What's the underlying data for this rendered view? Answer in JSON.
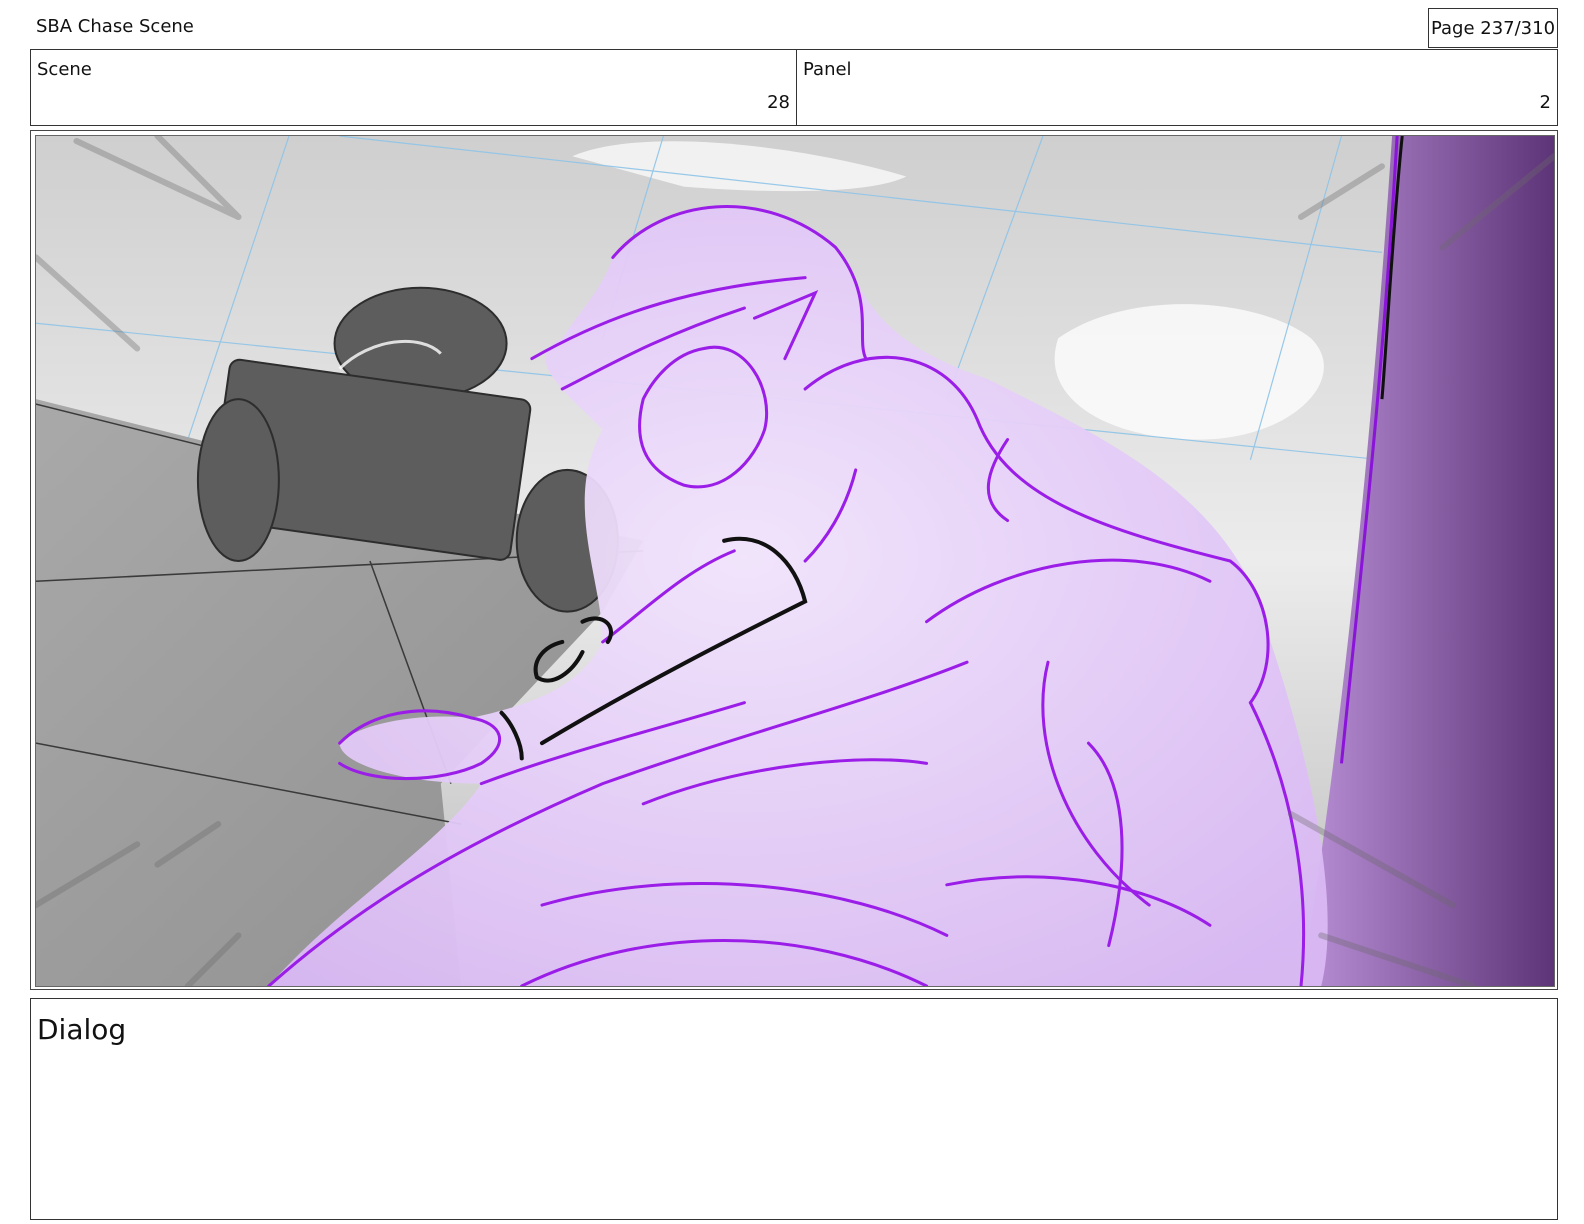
{
  "document": {
    "title": "SBA Chase Scene",
    "page_indicator": "Page 237/310"
  },
  "info": {
    "scene_label": "Scene",
    "scene_value": "28",
    "panel_label": "Panel",
    "panel_value": "2"
  },
  "artwork": {
    "description_icon": "storyboard-sketch",
    "colors": {
      "sketch_purple": "#9b1de8",
      "fill_lavender": "#e6cdfa",
      "shadow_purple": "#7b4a9a",
      "grayscale_bg": "#d9d9d9",
      "guide_blue": "#8ec4e8"
    }
  },
  "dialog": {
    "label": "Dialog",
    "text": ""
  }
}
